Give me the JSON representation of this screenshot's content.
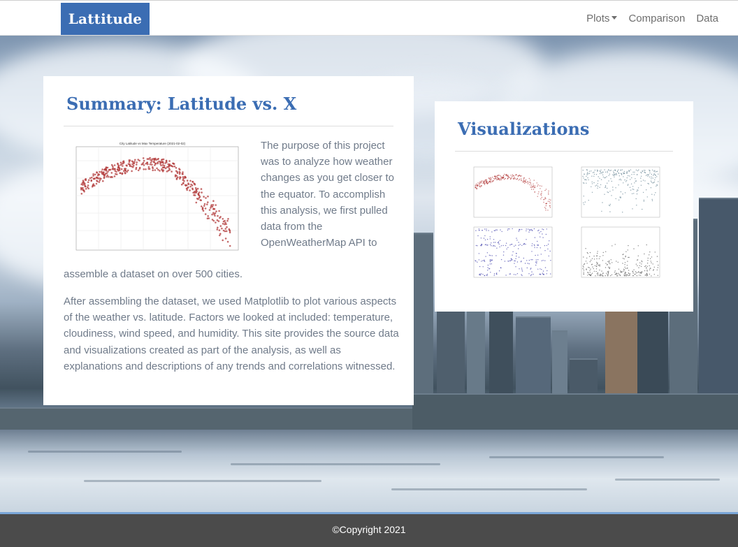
{
  "navbar": {
    "brand": "Lattitude",
    "links": [
      {
        "label": "Plots",
        "dropdown": true
      },
      {
        "label": "Comparison"
      },
      {
        "label": "Data"
      }
    ]
  },
  "summary": {
    "title": "Summary: Latitude vs. X",
    "image_title": "City Latitude vs Max Temperature (2021-02-02)",
    "paragraph_1_wrapped": "The purpose of this project was to analyze how weather changes as you get closer to the equator. To accomplish this analysis, we first pulled data from the OpenWeatherMap API to",
    "paragraph_1_tail": "assemble a dataset on over 500 cities.",
    "paragraph_2": "After assembling the dataset, we used Matplotlib to plot various aspects of the weather vs. latitude. Factors we looked at included: temperature, cloudiness, wind speed, and humidity. This site provides the source data and visualizations created as part of the analysis, as well as explanations and descriptions of any trends and correlations witnessed."
  },
  "visualizations": {
    "title": "Visualizations",
    "thumbnails": [
      {
        "name": "temperature",
        "color": "#b23a3a"
      },
      {
        "name": "humidity",
        "color": "#5f7f8f"
      },
      {
        "name": "cloudiness",
        "color": "#3a3aa8"
      },
      {
        "name": "wind-speed",
        "color": "#555555"
      }
    ]
  },
  "footer": {
    "text": "©Copyright 2021"
  },
  "colors": {
    "brand": "#3b6db3",
    "footer_bg": "#4b4b4b",
    "footer_accent": "#7aa6d8"
  }
}
